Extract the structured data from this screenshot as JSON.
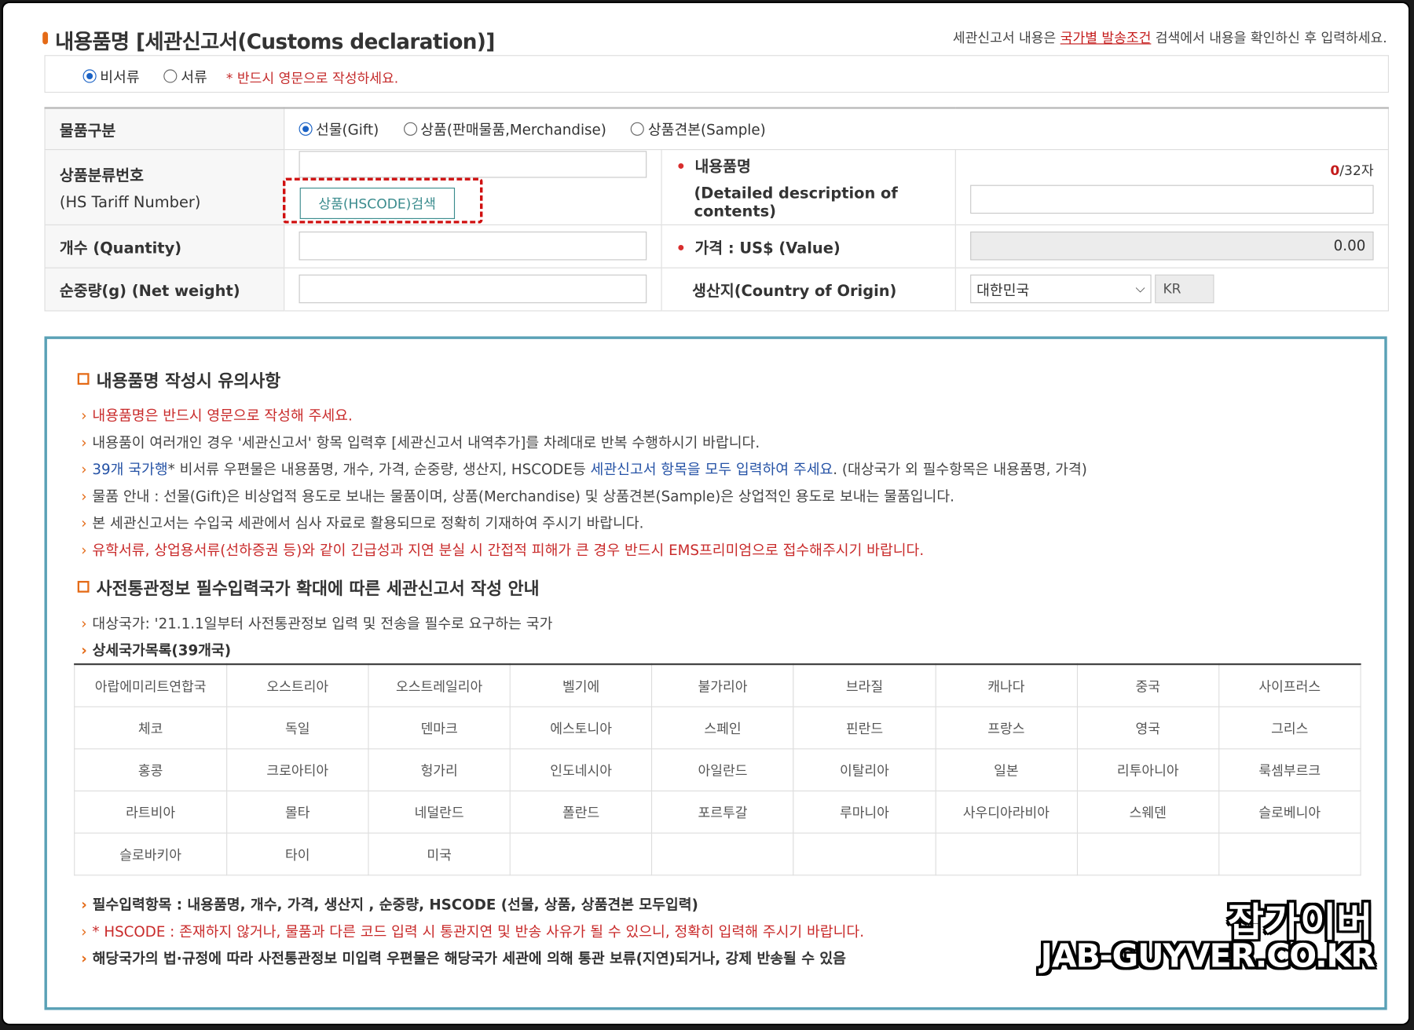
{
  "header": {
    "title": "내용품명 [세관신고서(Customs declaration)]",
    "note_prefix": "세관신고서 내용은 ",
    "note_link": "국가별 발송조건",
    "note_suffix": " 검색에서 내용을 확인하신 후 입력하세요."
  },
  "doc_type": {
    "options": [
      "비서류",
      "서류"
    ],
    "selected": "비서류",
    "warning": "* 반드시 영문으로 작성하세요."
  },
  "form": {
    "category_label": "물품구분",
    "category_options": [
      "선물(Gift)",
      "상품(판매물품,Merchandise)",
      "상품견본(Sample)"
    ],
    "category_selected": "선물(Gift)",
    "hs_label": "상품분류번호",
    "hs_label_en": "(HS Tariff Number)",
    "hs_value": "",
    "hs_button": "상품(HSCODE)검색",
    "desc_label": "내용품명",
    "desc_label_en": "(Detailed description of contents)",
    "desc_count": "0",
    "desc_max": "/32자",
    "desc_value": "",
    "qty_label": "개수 (Quantity)",
    "qty_value": "",
    "value_label": "가격 : US$ (Value)",
    "value_value": "0.00",
    "weight_label": "순중량(g) (Net weight)",
    "weight_value": "",
    "origin_label": "생산지(Country of Origin)",
    "origin_selected": "대한민국",
    "origin_code": "KR"
  },
  "notice": {
    "title1": "내용품명 작성시 유의사항",
    "items": [
      "내용품명은 반드시 영문으로 작성해 주세요.",
      "내용품이 여러개인 경우 '세관신고서' 항목 입력후 [세관신고서 내역추가]를 차례대로 반복 수행하시기 바랍니다.",
      "39개 국가행",
      "* 비서류 우편물은 내용품명, 개수, 가격, 순중량, 생산지, HSCODE등 ",
      "세관신고서 항목을 모두 입력하여 주세요",
      ". (대상국가 외 필수항목은 내용품명, 가격)",
      "물품 안내 : 선물(Gift)은 비상업적 용도로 보내는 물품이며, 상품(Merchandise) 및 상품견본(Sample)은 상업적인 용도로 보내는 물품입니다.",
      "본 세관신고서는 수입국 세관에서 심사 자료로 활용되므로 정확히 기재하여 주시기 바랍니다.",
      "유학서류, 상업용서류(선하증권 등)와 같이 긴급성과 지연 분실 시 간접적 피해가 큰 경우 반드시 EMS프리미엄으로 접수해주시기 바랍니다."
    ],
    "title2": "사전통관정보 필수입력국가 확대에 따른 세관신고서 작성 안내",
    "target": "대상국가: '21.1.1일부터 사전통관정보 입력 및 전송을 필수로 요구하는 국가",
    "list_title": "상세국가목록(39개국)",
    "countries": [
      [
        "아랍에미리트연합국",
        "오스트리아",
        "오스트레일리아",
        "벨기에",
        "불가리아",
        "브라질",
        "캐나다",
        "중국",
        "사이프러스"
      ],
      [
        "체코",
        "독일",
        "덴마크",
        "에스토니아",
        "스페인",
        "핀란드",
        "프랑스",
        "영국",
        "그리스"
      ],
      [
        "홍콩",
        "크로아티아",
        "헝가리",
        "인도네시아",
        "아일란드",
        "이탈리아",
        "일본",
        "리투아니아",
        "룩셈부르크"
      ],
      [
        "라트비아",
        "몰타",
        "네덜란드",
        "폴란드",
        "포르투갈",
        "루마니아",
        "사우디아라비아",
        "스웨덴",
        "슬로베니아"
      ],
      [
        "슬로바키아",
        "타이",
        "미국",
        "",
        "",
        "",
        "",
        "",
        ""
      ]
    ],
    "required": "필수입력항목 : 내용품명, 개수, 가격, 생산지 , 순중량, HSCODE (선물, 상품, 상품견본 모두입력)",
    "hscode_warn": "* HSCODE : 존재하지 않거나, 물품과 다른 코드 입력 시 통관지연 및 반송 사유가 될 수 있으니, 정확히 입력해 주시기 바랍니다.",
    "law": "해당국가의 법·규정에 따라 사전통관정보 미입력 우편물은 해당국가 세관에 의해 통관 보류(지연)되거나, 강제 반송될 수 있음"
  },
  "watermark": {
    "line1": "잡가이버",
    "line2": "JAB-GUYVER.CO.KR"
  }
}
